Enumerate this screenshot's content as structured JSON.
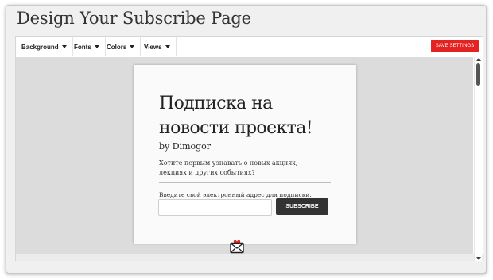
{
  "dialog": {
    "title": "Design Your Subscribe Page"
  },
  "toolbar": {
    "menus": [
      {
        "label": "Background"
      },
      {
        "label": "Fonts"
      },
      {
        "label": "Colors"
      },
      {
        "label": "Views"
      }
    ],
    "save_label": "SAVE SETTINGS"
  },
  "preview": {
    "heading": "Подписка на новости проекта!",
    "byline": "by Dimogor",
    "description": "Хотите первым узнавать о новых акциях, лекциях и других событиях?",
    "email_label": "Введите свой электронный адрес для подписки.",
    "email_value": "",
    "subscribe_label": "SUBSCRIBE"
  },
  "icons": {
    "logo": "envelope-heart-icon",
    "scroll_up": "arrow-up-icon",
    "scroll_down": "arrow-down-icon",
    "menu_caret": "caret-down-icon"
  },
  "colors": {
    "save_button": "#e52222",
    "subscribe_button": "#333333",
    "canvas_background": "#dcdcdc"
  }
}
